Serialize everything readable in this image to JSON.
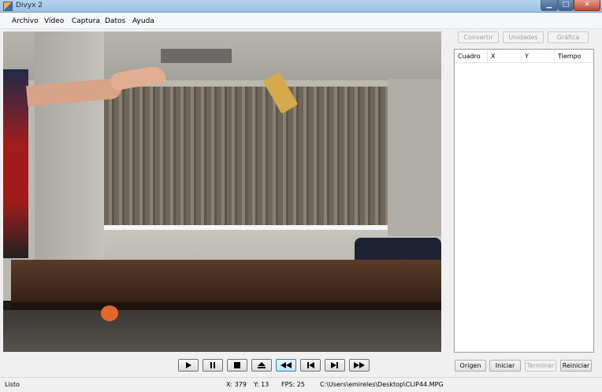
{
  "window": {
    "title": "Divyx 2"
  },
  "menu": [
    "Archivo",
    "Video",
    "Captura",
    "Datos",
    "Ayuda"
  ],
  "top_buttons": {
    "convertir": "Convertir",
    "unidades": "Unidades",
    "grafica": "Gráfica"
  },
  "table": {
    "columns": [
      "Cuadro",
      "X",
      "Y",
      "Tiempo"
    ]
  },
  "bottom_buttons": {
    "origen": "Origen",
    "iniciar": "Iniciar",
    "terminar": "Terminar",
    "reiniciar": "Reiniciar"
  },
  "transport": [
    "play",
    "pause",
    "stop",
    "eject",
    "rewind",
    "step-back",
    "step-forward",
    "fast-forward"
  ],
  "status": {
    "state": "Listo",
    "x": "X: 379",
    "y": "Y: 13",
    "fps": "FPS: 25",
    "path": "C:\\Users\\emireles\\Desktop\\CLIP44.MPG"
  }
}
